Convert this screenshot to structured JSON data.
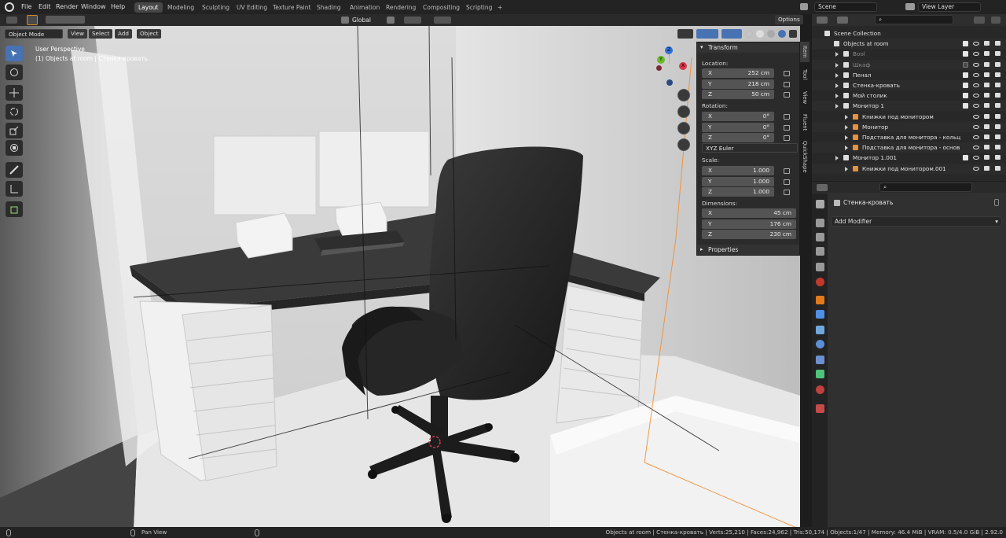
{
  "menu": [
    "File",
    "Edit",
    "Render",
    "Window",
    "Help"
  ],
  "workspaces": [
    "Layout",
    "Modeling",
    "Sculpting",
    "UV Editing",
    "Texture Paint",
    "Shading",
    "Animation",
    "Rendering",
    "Compositing",
    "Scripting"
  ],
  "active_workspace": "Layout",
  "add_tab": "+",
  "scene": {
    "label": "Scene",
    "view_layer": "View Layer"
  },
  "viewport_header": {
    "orientation": "Global",
    "options": "Options"
  },
  "mode_bar": {
    "mode": "Object Mode",
    "items": [
      "View",
      "Select",
      "Add",
      "Object"
    ]
  },
  "overlay": {
    "perspective": "User Perspective",
    "collection": "(1) Objects at room | Стенка-кровать"
  },
  "transform_panel": {
    "title": "Transform",
    "location_label": "Location:",
    "location": [
      {
        "axis": "X",
        "value": "252 cm"
      },
      {
        "axis": "Y",
        "value": "218 cm"
      },
      {
        "axis": "Z",
        "value": "50 cm"
      }
    ],
    "rotation_label": "Rotation:",
    "rotation": [
      {
        "axis": "X",
        "value": "0°"
      },
      {
        "axis": "Y",
        "value": "0°"
      },
      {
        "axis": "Z",
        "value": "0°"
      }
    ],
    "rotation_mode": "XYZ Euler",
    "scale_label": "Scale:",
    "scale": [
      {
        "axis": "X",
        "value": "1.000"
      },
      {
        "axis": "Y",
        "value": "1.000"
      },
      {
        "axis": "Z",
        "value": "1.000"
      }
    ],
    "dimensions_label": "Dimensions:",
    "dimensions": [
      {
        "axis": "X",
        "value": "45 cm"
      },
      {
        "axis": "Y",
        "value": "176 cm"
      },
      {
        "axis": "Z",
        "value": "230 cm"
      }
    ],
    "properties": "Properties"
  },
  "sidebar_tabs": [
    "Item",
    "Tool",
    "View",
    "Fluent",
    "QuickShape"
  ],
  "gizmo": {
    "x": "X",
    "y": "Y",
    "z": "Z"
  },
  "outliner": {
    "rows": [
      {
        "label": "Scene Collection",
        "indent": 0,
        "check": false
      },
      {
        "label": "Objects at room",
        "indent": 1,
        "check": true
      },
      {
        "label": "Bool",
        "indent": 2,
        "check": true,
        "dim": true
      },
      {
        "label": "Шкаф",
        "indent": 2,
        "check": false,
        "dim": true
      },
      {
        "label": "Пенал",
        "indent": 2,
        "check": true
      },
      {
        "label": "Стенка-кровать",
        "indent": 2,
        "check": true
      },
      {
        "label": "Мой столик",
        "indent": 2,
        "check": true
      },
      {
        "label": "Монитор 1",
        "indent": 2,
        "check": true
      },
      {
        "label": "Книжки под монитором",
        "indent": 3,
        "check": false
      },
      {
        "label": "Монитор",
        "indent": 3,
        "check": false
      },
      {
        "label": "Подставка для монитора - кольц",
        "indent": 3,
        "check": false
      },
      {
        "label": "Подставка для монитора - основ",
        "indent": 3,
        "check": false
      },
      {
        "label": "Монитор 1.001",
        "indent": 2,
        "check": true
      },
      {
        "label": "Книжки под монитором.001",
        "indent": 3,
        "check": false
      }
    ]
  },
  "properties_editor": {
    "object_name": "Стенка-кровать",
    "add_modifier": "Add Modifier"
  },
  "status_bar": {
    "left": "Pan View",
    "stats": "Objects at room | Стенка-кровать | Verts:25,210 | Faces:24,962 | Tris:50,174 | Objects:1/47 | Memory: 46.4 MiB | VRAM: 0.5/4.0 GiB | 2.92.0"
  },
  "colors": {
    "accent": "#4772b3",
    "active_outline": "#f28a29",
    "panel": "#2b2b2b"
  }
}
